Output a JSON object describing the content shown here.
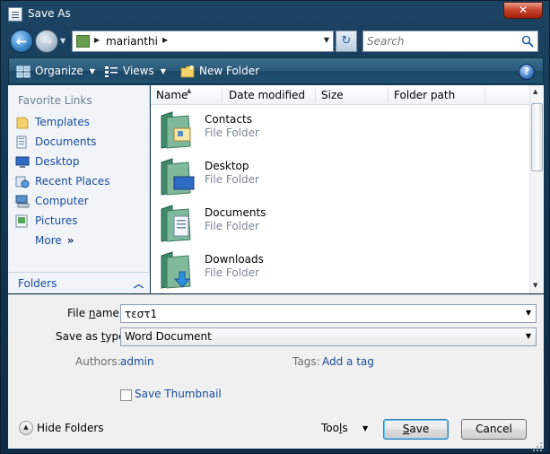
{
  "window": {
    "title": "Save As",
    "close_glyph": "✕"
  },
  "address": {
    "back_icon": "back-arrow-icon",
    "forward_icon": "forward-arrow-icon",
    "segments": [
      "marianthi"
    ],
    "search_placeholder": "Search"
  },
  "toolbar": {
    "organize_label": "Organize",
    "views_label": "Views",
    "new_folder_label": "New Folder",
    "help_glyph": "?"
  },
  "nav": {
    "heading": "Favorite Links",
    "links": [
      {
        "label": "Templates",
        "icon": "folder-icon"
      },
      {
        "label": "Documents",
        "icon": "documents-icon"
      },
      {
        "label": "Desktop",
        "icon": "desktop-icon"
      },
      {
        "label": "Recent Places",
        "icon": "recent-places-icon"
      },
      {
        "label": "Computer",
        "icon": "computer-icon"
      },
      {
        "label": "Pictures",
        "icon": "pictures-icon"
      }
    ],
    "more_label": "More",
    "more_glyph": "»",
    "folders_label": "Folders"
  },
  "file_list": {
    "columns": [
      "Name",
      "Date modified",
      "Size",
      "Folder path"
    ],
    "rows": [
      {
        "name": "Contacts",
        "type": "File Folder",
        "overlay": "contacts"
      },
      {
        "name": "Desktop",
        "type": "File Folder",
        "overlay": "desktop"
      },
      {
        "name": "Documents",
        "type": "File Folder",
        "overlay": "documents"
      },
      {
        "name": "Downloads",
        "type": "File Folder",
        "overlay": "downloads"
      }
    ]
  },
  "form": {
    "file_name_label_pre": "File ",
    "file_name_label_u": "n",
    "file_name_label_post": "ame:",
    "file_name_value": "τεστ1",
    "save_type_label_pre": "Save as ",
    "save_type_label_u": "t",
    "save_type_label_post": "ype:",
    "save_type_value": "Word Document",
    "authors_label": "Authors:",
    "authors_value": "admin",
    "tags_label": "Tags:",
    "tags_value": "Add a tag",
    "thumbnail_label": "Save Thumbnail",
    "thumbnail_checked": false
  },
  "buttons": {
    "hide_folders_label": "Hide Folders",
    "tools_pre": "Too",
    "tools_u": "l",
    "tools_post": "s",
    "save_u": "S",
    "save_post": "ave",
    "cancel_label": "Cancel"
  },
  "colors": {
    "frame": "#133752",
    "toolbar": "#29587a",
    "link": "#1a4b9c",
    "folder": "#6aa07a"
  }
}
